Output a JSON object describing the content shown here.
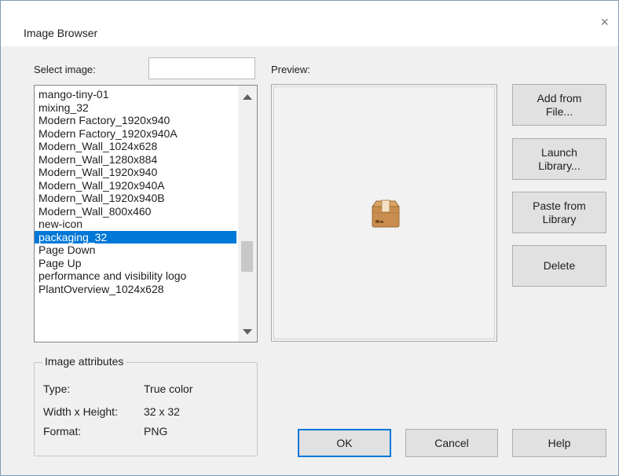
{
  "dialog": {
    "title": "Image Browser",
    "close_glyph": "×"
  },
  "select": {
    "label": "Select image:",
    "filter_value": ""
  },
  "preview": {
    "label": "Preview:",
    "icon": "package-box-icon"
  },
  "image_list": {
    "items": [
      "mango-tiny-01",
      "mixing_32",
      "Modern Factory_1920x940",
      "Modern Factory_1920x940A",
      "Modern_Wall_1024x628",
      "Modern_Wall_1280x884",
      "Modern_Wall_1920x940",
      "Modern_Wall_1920x940A",
      "Modern_Wall_1920x940B",
      "Modern_Wall_800x460",
      "new-icon",
      "packaging_32",
      "Page Down",
      "Page Up",
      "performance and visibility logo",
      "PlantOverview_1024x628"
    ],
    "selected": "packaging_32"
  },
  "side_buttons": {
    "add_from_file": "Add from\nFile...",
    "launch_library": "Launch\nLibrary...",
    "paste_from_library": "Paste from\nLibrary",
    "delete": "Delete"
  },
  "attributes": {
    "legend": "Image attributes",
    "type_label": "Type:",
    "type_value": "True color",
    "size_label": "Width x Height:",
    "size_value": "32 x 32",
    "format_label": "Format:",
    "format_value": "PNG"
  },
  "footer": {
    "ok": "OK",
    "cancel": "Cancel",
    "help": "Help"
  },
  "colors": {
    "selection": "#0078d7",
    "dialog_bg": "#f0f0f0",
    "button_bg": "#e1e1e1"
  }
}
